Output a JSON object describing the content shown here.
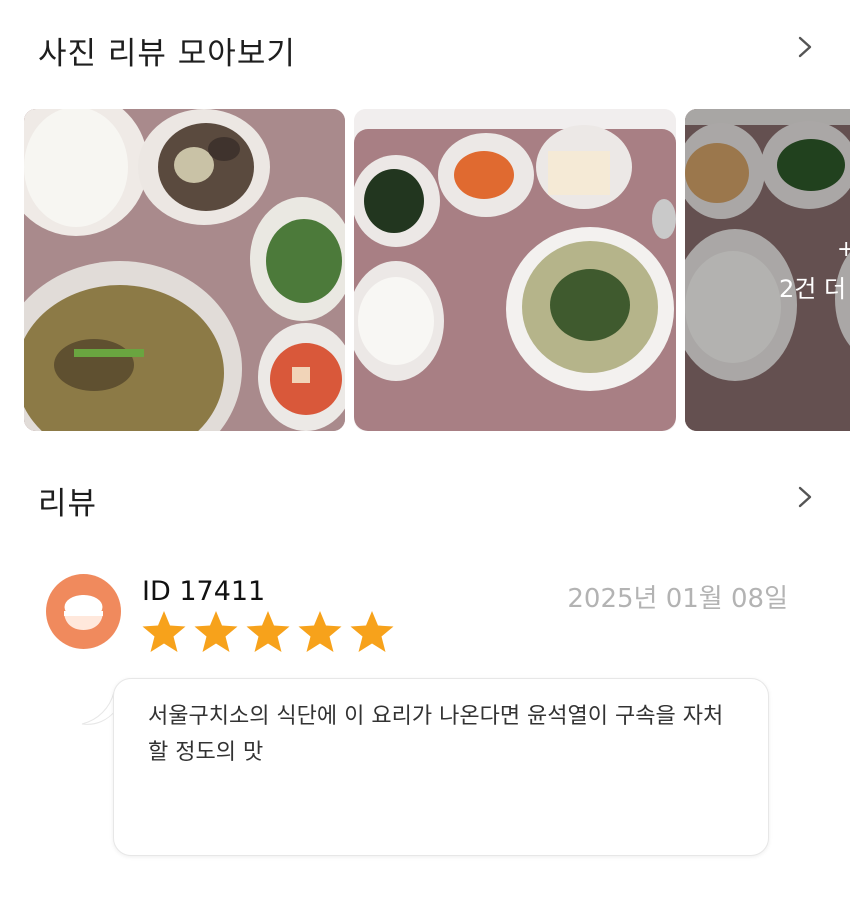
{
  "photo_reviews": {
    "title": "사진 리뷰 모아보기",
    "chevron_icon": "chevron-right-icon",
    "more_overlay": {
      "plus": "+",
      "label": "2건 더"
    }
  },
  "reviews": {
    "title": "리뷰",
    "chevron_icon": "chevron-right-icon",
    "items": [
      {
        "reviewer_id": "ID 17411",
        "date": "2025년 01월 08일",
        "rating": 5,
        "avatar_icon": "rice-bowl-icon",
        "text": "서울구치소의 식단에 이 요리가 나온다면 윤석열이 구속을 자처할 정도의 맛"
      }
    ]
  },
  "colors": {
    "star": "#f7a21b",
    "avatar": "#f08a5d",
    "date": "#b3b3b3",
    "tray": "#a98a8c"
  }
}
